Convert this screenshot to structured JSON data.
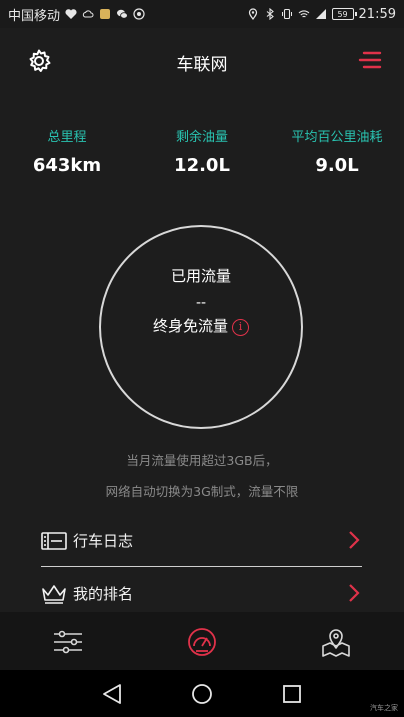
{
  "status_bar": {
    "carrier": "中国移动",
    "battery": "59",
    "time": "21:59"
  },
  "header": {
    "title": "车联网"
  },
  "stats": [
    {
      "label": "总里程",
      "value": "643km"
    },
    {
      "label": "剩余油量",
      "value": "12.0L"
    },
    {
      "label": "平均百公里油耗",
      "value": "9.0L"
    }
  ],
  "data_usage": {
    "title": "已用流量",
    "value": "--",
    "plan": "终身免流量",
    "info_icon": "i"
  },
  "notes": {
    "line1": "当月流量使用超过3GB后，",
    "line2": "网络自动切换为3G制式，流量不限"
  },
  "menu": [
    {
      "label": "行车日志",
      "icon": "logbook-icon"
    },
    {
      "label": "我的排名",
      "icon": "crown-icon"
    }
  ],
  "bottom_nav": [
    {
      "name": "settings-sliders-icon"
    },
    {
      "name": "speedometer-icon"
    },
    {
      "name": "map-pin-icon"
    }
  ],
  "colors": {
    "accent_red": "#e0324a",
    "accent_teal": "#29c2b0",
    "background": "#1d1d1d"
  },
  "watermark": "汽车之家"
}
